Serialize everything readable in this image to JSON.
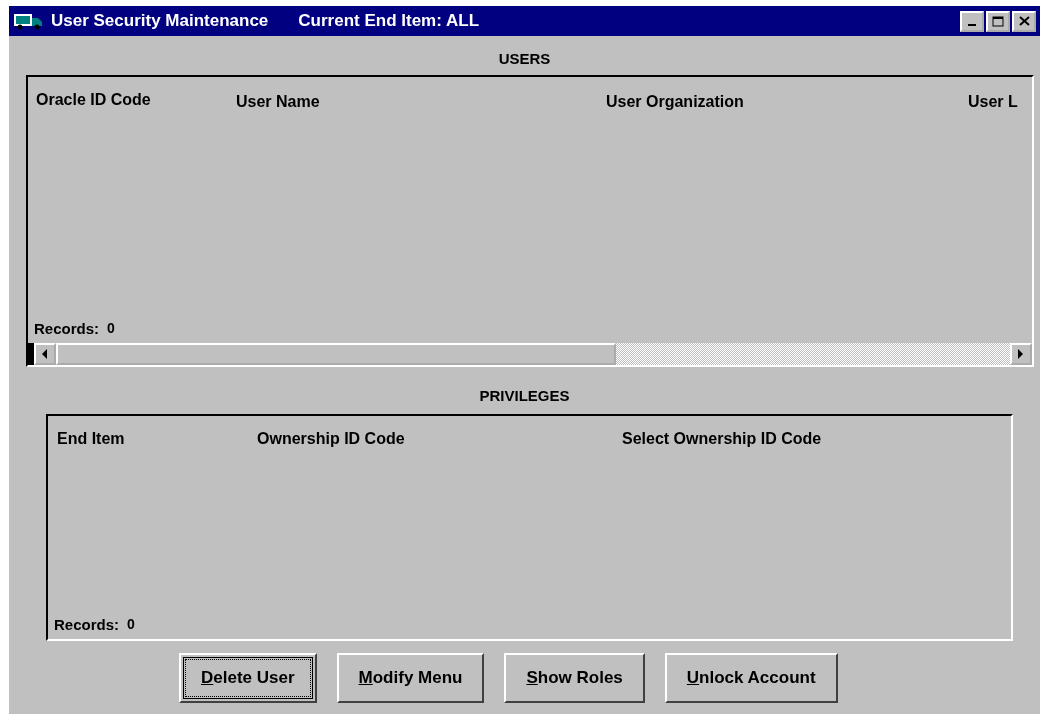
{
  "window": {
    "title": "User Security Maintenance",
    "subtitle": "Current End Item: ALL"
  },
  "users": {
    "heading": "USERS",
    "columns": [
      "Oracle ID Code",
      "User Name",
      "User Organization",
      "User L"
    ],
    "records_label": "Records:",
    "records_count": "0"
  },
  "privileges": {
    "heading": "PRIVILEGES",
    "columns": [
      "End Item",
      "Ownership ID Code",
      "Select Ownership ID Code"
    ],
    "records_label": "Records:",
    "records_count": "0"
  },
  "buttons": [
    {
      "label": "Delete User",
      "focused": true
    },
    {
      "label": "Modify Menu",
      "focused": false
    },
    {
      "label": "Show Roles",
      "focused": false
    },
    {
      "label": "Unlock Account",
      "focused": false
    }
  ]
}
